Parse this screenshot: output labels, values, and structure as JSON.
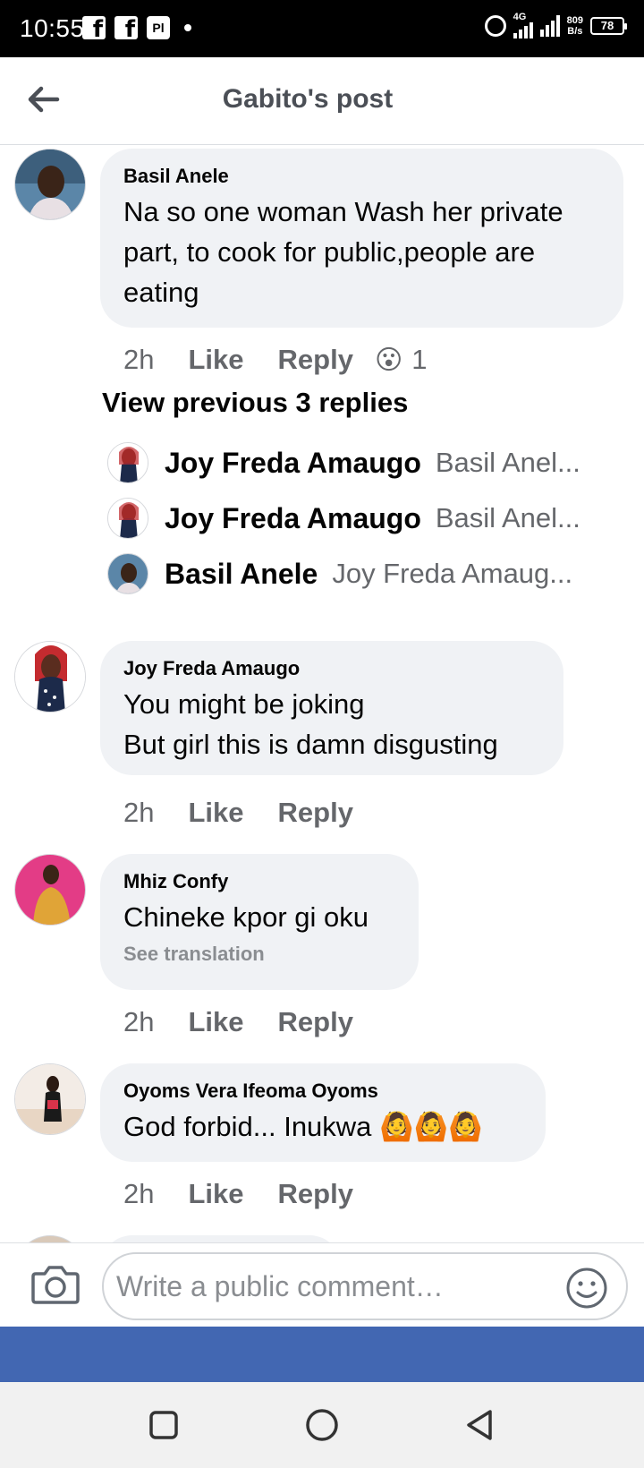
{
  "status_bar": {
    "time": "10:55",
    "network": "4G",
    "speed_value": "809",
    "speed_unit": "B/s",
    "battery": "78"
  },
  "header": {
    "title": "Gabito's post",
    "back_icon": "arrow-left-icon"
  },
  "comments": [
    {
      "author": "Basil Anele",
      "lines": [
        "Na so one woman Wash her private",
        "part, to cook for public,people are",
        "eating"
      ],
      "time": "2h",
      "like": "Like",
      "reply": "Reply",
      "reaction_emoji": "😮",
      "reaction_count": "1"
    },
    {
      "author": "Joy Freda Amaugo",
      "lines": [
        "You might be joking",
        "But girl this is damn disgusting"
      ],
      "time": "2h",
      "like": "Like",
      "reply": "Reply"
    },
    {
      "author": "Mhiz Confy",
      "lines": [
        "Chineke kpor gi  oku"
      ],
      "see_translation": "See translation",
      "time": "2h",
      "like": "Like",
      "reply": "Reply"
    },
    {
      "author": "Oyoms Vera Ifeoma Oyoms",
      "lines": [
        "God forbid... Inukwa 🙆🙆🙆"
      ],
      "time": "2h",
      "like": "Like",
      "reply": "Reply"
    }
  ],
  "replies_thread": {
    "view_previous": "View previous 3 replies",
    "replies": [
      {
        "name": "Joy Freda Amaugo",
        "snippet": "Basil Anel..."
      },
      {
        "name": "Joy Freda Amaugo",
        "snippet": "Basil Anel..."
      },
      {
        "name": "Basil Anele",
        "snippet": "Joy Freda Amaug..."
      }
    ]
  },
  "composer": {
    "placeholder": "Write a public comment…",
    "camera_icon": "camera-icon",
    "emoji_icon": "smiley-icon"
  },
  "colors": {
    "facebook_blue": "#4267b2",
    "bubble_bg": "#f0f2f5",
    "secondary_text": "#65676b"
  }
}
